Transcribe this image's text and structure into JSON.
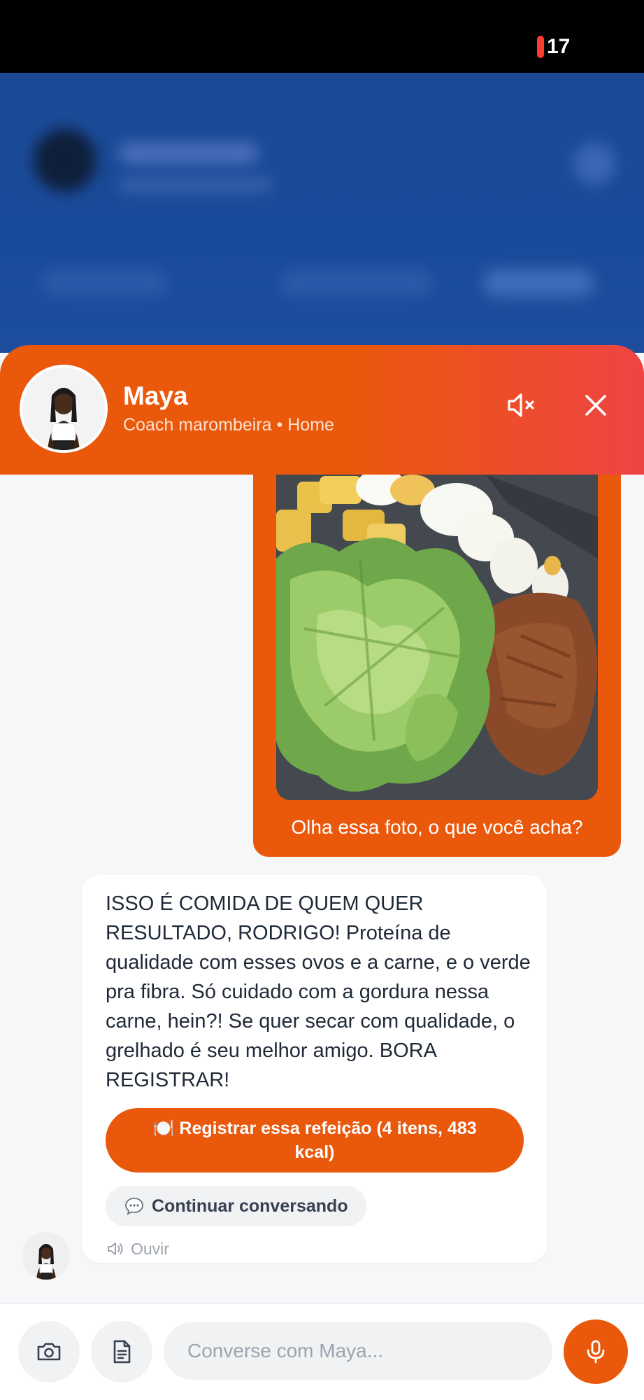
{
  "status_bar": {
    "battery": "17"
  },
  "header": {
    "name": "Maya",
    "subtitle": "Coach marombeira • Home"
  },
  "messages": {
    "user": {
      "text": "Olha essa foto, o que você acha?"
    },
    "bot": {
      "text": "ISSO É COMIDA DE QUEM QUER RESULTADO, RODRIGO! Proteína de qualidade com esses ovos e a carne, e o verde pra fibra. Só cuidado com a gordura nessa carne, hein?! Se quer secar com qualidade, o grelhado é seu melhor amigo. BORA REGISTRAR!",
      "register_label": "🍽️ Registrar essa refeição (4 itens, 483 kcal)",
      "continue_label": "Continuar conversando",
      "listen_label": "Ouvir"
    }
  },
  "input": {
    "placeholder": "Converse com Maya..."
  },
  "colors": {
    "accent": "#ea580c",
    "header_end": "#ef4444"
  },
  "icons": [
    "mute-icon",
    "close-icon",
    "chat-bubble-icon",
    "speaker-icon",
    "camera-icon",
    "document-icon",
    "mic-icon"
  ]
}
